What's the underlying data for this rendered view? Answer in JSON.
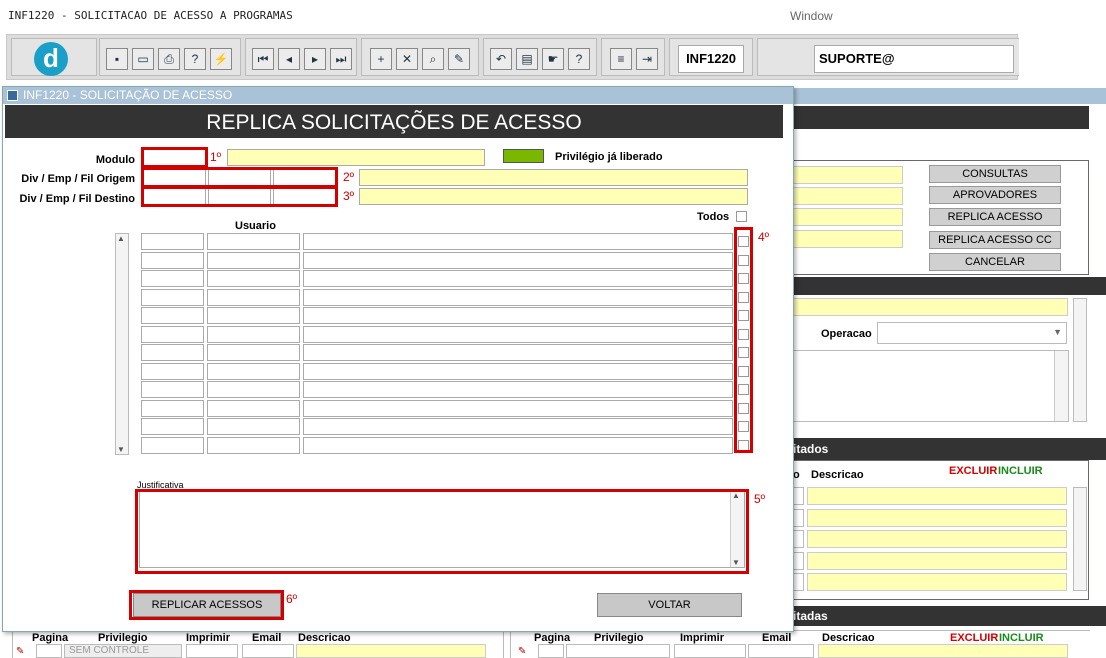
{
  "app": {
    "title": "INF1220 - SOLICITACAO DE ACESSO A PROGRAMAS",
    "window_menu": "Window"
  },
  "toolbar": {
    "program_code": "INF1220",
    "user": "SUPORTE@"
  },
  "modal": {
    "title": "INF1220 - SOLICITAÇÃO DE ACESSO",
    "header": "REPLICA SOLICITAÇÕES DE ACESSO",
    "modulo_label": "Modulo",
    "origem_label": "Div / Emp / Fil Origem",
    "destino_label": "Div / Emp / Fil Destino",
    "legend_label": "Privilégio já liberado",
    "legend_color": "#7ab800",
    "usuario_header": "Usuario",
    "todos_label": "Todos",
    "justificativa_label": "Justificativa",
    "replicar_label": "REPLICAR ACESSOS",
    "voltar_label": "VOLTAR",
    "steps": [
      "1º",
      "2º",
      "3º",
      "4º",
      "5º",
      "6º"
    ]
  },
  "bg": {
    "buttons": [
      "CONSULTAS",
      "APROVADORES",
      "REPLICA ACESSO",
      "REPLICA ACESSO CC",
      "CANCELAR"
    ],
    "operacao_label": "Operacao",
    "section1": "itados",
    "section2": "itadas",
    "descricao_label": "Descricao",
    "excluir_label": "EXCLUIR",
    "incluir_label": "INCLUIR",
    "bottom_left": {
      "pagina": "Pagina",
      "privilegio": "Privilegio",
      "imprimir": "Imprimir",
      "email": "Email",
      "descricao": "Descricao",
      "sem_controle": "SEM CONTROLE"
    },
    "bottom_right": {
      "pagina": "Pagina",
      "privilegio": "Privilegio",
      "imprimir": "Imprimir",
      "email": "Email",
      "descricao": "Descricao",
      "excluir": "EXCLUIR",
      "incluir": "INCLUIR"
    }
  }
}
